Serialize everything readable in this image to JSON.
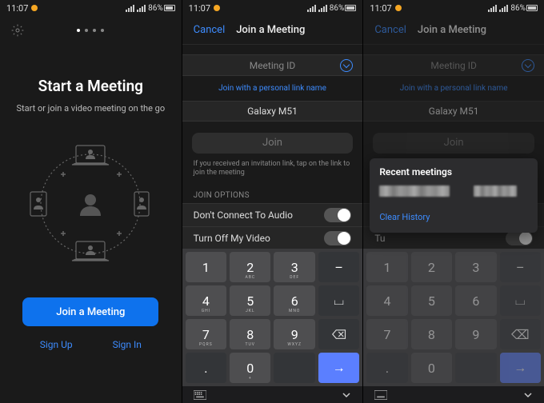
{
  "status": {
    "time": "11:07",
    "battery": "86%"
  },
  "screen1": {
    "title": "Start a Meeting",
    "subtitle": "Start or join a video meeting on the go",
    "join_btn": "Join a Meeting",
    "signup": "Sign Up",
    "signin": "Sign In"
  },
  "screen2": {
    "cancel": "Cancel",
    "title": "Join a Meeting",
    "meeting_id_placeholder": "Meeting ID",
    "personal_link": "Join with a personal link name",
    "display_name": "Galaxy M51",
    "join": "Join",
    "hint": "If you received an invitation link, tap on the link to join the meeting",
    "section": "JOIN OPTIONS",
    "opt_audio": "Don't Connect To Audio",
    "opt_video": "Turn Off My Video",
    "keys": {
      "r1": [
        "1",
        "2",
        "3"
      ],
      "r2": [
        "4",
        "5",
        "6"
      ],
      "r3": [
        "7",
        "8",
        "9"
      ],
      "r4": [
        "0"
      ],
      "subs": {
        "2": "ABC",
        "3": "DEF",
        "4": "GHI",
        "5": "JKL",
        "6": "MNO",
        "7": "PQRS",
        "8": "TUV",
        "9": "WXYZ",
        "0": "+"
      }
    }
  },
  "screen3": {
    "popup_title": "Recent meetings",
    "clear": "Clear History"
  }
}
